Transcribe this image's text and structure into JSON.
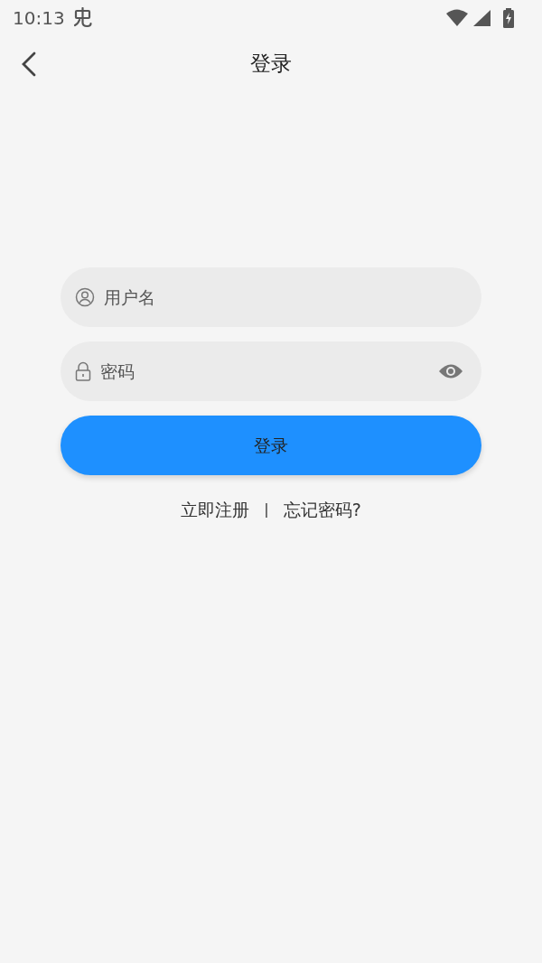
{
  "status_bar": {
    "time": "10:13"
  },
  "header": {
    "title": "登录"
  },
  "fields": [
    {
      "kind": "user",
      "placeholder": "用户名"
    },
    {
      "kind": "password",
      "placeholder": "密码"
    }
  ],
  "login_button": "登录",
  "links": [
    {
      "kind": "link",
      "label": "立即注册"
    },
    {
      "kind": "separator",
      "label": "|"
    },
    {
      "kind": "link",
      "label": "忘记密码?"
    }
  ]
}
